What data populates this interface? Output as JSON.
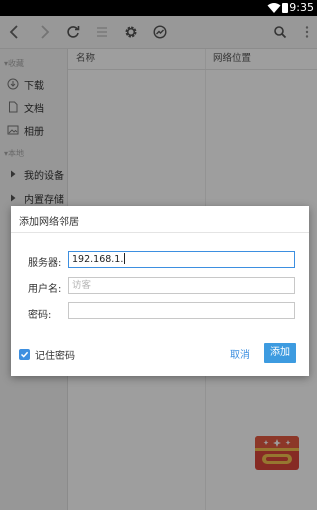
{
  "status_bar": {
    "time": "9:35"
  },
  "toolbar": {
    "icons": [
      "back-icon",
      "forward-icon",
      "refresh-icon",
      "list-icon",
      "settings-icon",
      "speedometer-icon",
      "search-icon",
      "more-icon"
    ]
  },
  "sidebar": {
    "favorites_header": "▾收藏",
    "local_header": "▾本地",
    "items": [
      {
        "label": "下载",
        "icon": "download-icon"
      },
      {
        "label": "文档",
        "icon": "document-icon"
      },
      {
        "label": "相册",
        "icon": "image-icon"
      },
      {
        "label": "我的设备",
        "icon": "expand-arrow-icon"
      },
      {
        "label": "内置存储",
        "icon": "expand-arrow-icon"
      }
    ]
  },
  "content": {
    "columns": [
      "名称",
      "网络位置"
    ]
  },
  "dialog": {
    "title": "添加网络邻居",
    "server_label": "服务器:",
    "server_value": "192.168.1.",
    "username_label": "用户名:",
    "username_placeholder": "访客",
    "password_label": "密码:",
    "password_value": "",
    "remember_label": "记住密码",
    "remember_checked": true,
    "cancel_label": "取消",
    "add_label": "添加"
  },
  "colors": {
    "accent": "#3d8fe0",
    "status_bar": "#000000",
    "chest": "#d8463a"
  }
}
